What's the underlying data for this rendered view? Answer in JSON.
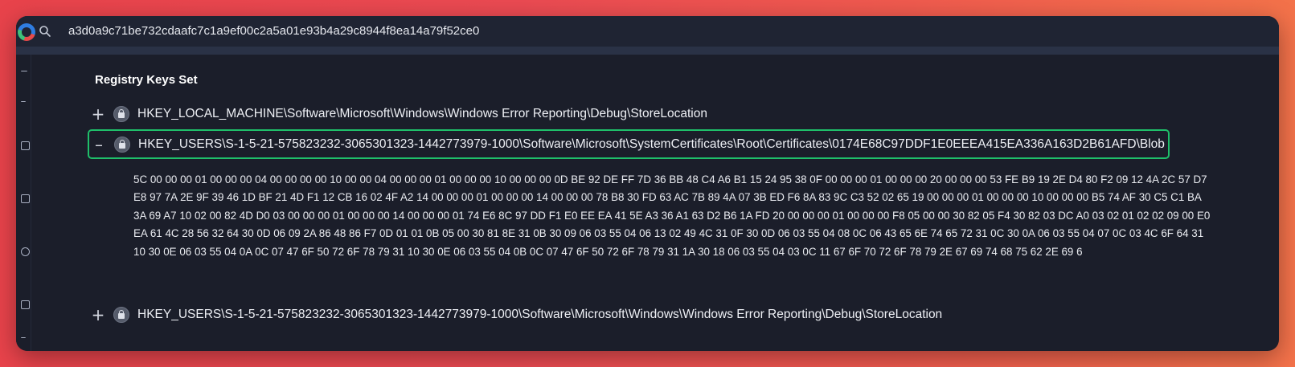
{
  "search": {
    "query": "a3d0a9c71be732cdaafc7c1a9ef00c2a5a01e93b4a29c8944f8ea14a79f52ce0"
  },
  "section": {
    "title": "Registry Keys Set"
  },
  "registry_keys": [
    {
      "toggle": "+",
      "path": "HKEY_LOCAL_MACHINE\\Software\\Microsoft\\Windows\\Windows Error Reporting\\Debug\\StoreLocation",
      "expanded": false
    },
    {
      "toggle": "–",
      "path": "HKEY_USERS\\S-1-5-21-575823232-3065301323-1442773979-1000\\Software\\Microsoft\\SystemCertificates\\Root\\Certificates\\0174E68C97DDF1E0EEEA415EA336A163D2B61AFD\\Blob",
      "expanded": true,
      "value": "5C 00 00 00 01 00 00 00 04 00 00 00 00 10 00 00 04 00 00 00 01 00 00 00 10 00 00 00 0D BE 92 DE FF 7D 36 BB 48 C4 A6 B1 15 24 95 38 0F 00 00 00 01 00 00 00 20 00 00 00 53 FE B9 19 2E D4 80 F2 09 12 4A 2C 57 D7 E8 97 7A 2E 9F 39 46 1D BF 21 4D F1 12 CB 16 02 4F A2 14 00 00 00 01 00 00 00 14 00 00 00 78 B8 30 FD 63 AC 7B 89 4A 07 3B ED F6 8A 83 9C C3 52 02 65 19 00 00 00 01 00 00 00 10 00 00 00 B5 74 AF 30 C5 C1 BA 3A 69 A7 10 02 00 82 4D D0 03 00 00 00 01 00 00 00 14 00 00 00 01 74 E6 8C 97 DD F1 E0 EE EA 41 5E A3 36 A1 63 D2 B6 1A FD 20 00 00 00 01 00 00 00 F8 05 00 00 30 82 05 F4 30 82 03 DC A0 03 02 01 02 02 09 00 E0 EA 61 4C 28 56 32 64 30 0D 06 09 2A 86 48 86 F7 0D 01 01 0B 05 00 30 81 8E 31 0B 30 09 06 03 55 04 06 13 02 49 4C 31 0F 30 0D 06 03 55 04 08 0C 06 43 65 6E 74 65 72 31 0C 30 0A 06 03 55 04 07 0C 03 4C 6F 64 31 10 30 0E 06 03 55 04 0A 0C 07 47 6F 50 72 6F 78 79 31 10 30 0E 06 03 55 04 0B 0C 07 47 6F 50 72 6F 78 79 31 1A 30 18 06 03 55 04 03 0C 11 67 6F 70 72 6F 78 79 2E 67 69 74 68 75 62 2E 69 6"
    },
    {
      "toggle": "+",
      "path": "HKEY_USERS\\S-1-5-21-575823232-3065301323-1442773979-1000\\Software\\Microsoft\\Windows\\Windows Error Reporting\\Debug\\StoreLocation",
      "expanded": false
    }
  ],
  "colors": {
    "background_gradient_start": "#e8434b",
    "background_gradient_end": "#f3724a",
    "window_bg": "#1b1e2a",
    "selection_border": "#1fbf6a"
  },
  "icons": {
    "search": "search-icon",
    "registry_key": "registry-key-icon",
    "expand": "plus-icon",
    "collapse": "minus-icon"
  }
}
